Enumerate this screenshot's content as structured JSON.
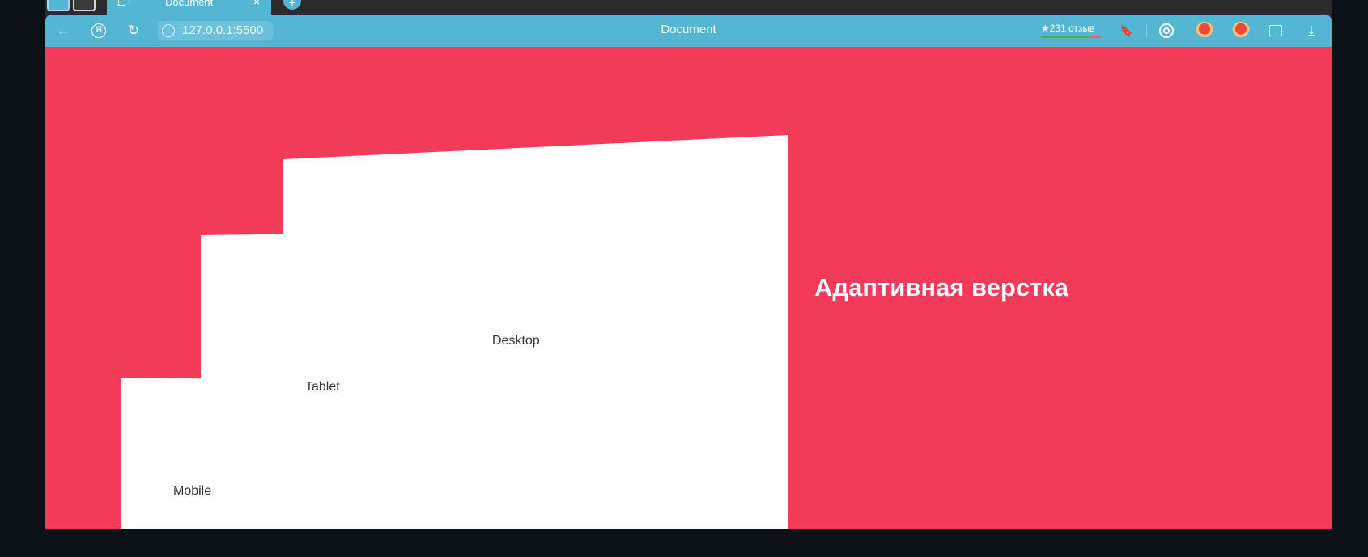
{
  "tabs": {
    "active_title": "Document",
    "close_glyph": "×",
    "new_tab_glyph": "+"
  },
  "toolbar": {
    "back_icon": "←",
    "yandex_icon": "Я",
    "reload_icon": "↻",
    "url": "127.0.0.1:5500",
    "page_title": "Document",
    "rating_text": "★231 отзыв",
    "bookmark_icon": "🔖",
    "download_icon": "⤓"
  },
  "page": {
    "headline": "Адаптивная верстка",
    "devices": {
      "desktop": "Desktop",
      "tablet": "Tablet",
      "mobile": "Mobile"
    }
  },
  "colors": {
    "accent": "#55b6d3",
    "page_background": "#f23a59",
    "outer_background": "#0c1118"
  }
}
